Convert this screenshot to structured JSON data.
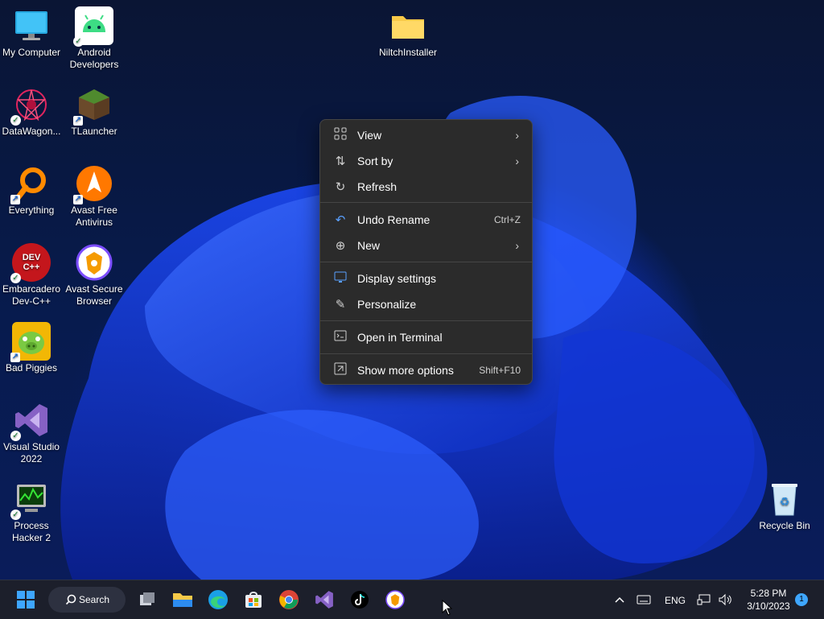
{
  "desktop": {
    "icons": [
      {
        "label": "My Computer",
        "icon": "monitor-icon"
      },
      {
        "label": "Android Developers",
        "icon": "android-icon"
      },
      {
        "label": "NiltchInstaller",
        "icon": "folder-icon"
      },
      {
        "label": "DataWagon...",
        "icon": "datawagon-icon"
      },
      {
        "label": "TLauncher",
        "icon": "tlauncher-icon"
      },
      {
        "label": "Everything",
        "icon": "everything-search-icon"
      },
      {
        "label": "Avast Free Antivirus",
        "icon": "avast-icon"
      },
      {
        "label": "Embarcadero Dev-C++",
        "icon": "devcpp-icon",
        "text": "DEV C++"
      },
      {
        "label": "Avast Secure Browser",
        "icon": "avast-browser-icon"
      },
      {
        "label": "Bad Piggies",
        "icon": "bad-piggies-icon"
      },
      {
        "label": "Visual Studio 2022",
        "icon": "visual-studio-icon"
      },
      {
        "label": "Process Hacker 2",
        "icon": "process-hacker-icon"
      },
      {
        "label": "Recycle Bin",
        "icon": "recycle-bin-icon"
      }
    ]
  },
  "context_menu": {
    "items": [
      {
        "label": "View",
        "icon": "grid-view-icon",
        "submenu": true
      },
      {
        "label": "Sort by",
        "icon": "sort-icon",
        "submenu": true
      },
      {
        "label": "Refresh",
        "icon": "refresh-icon"
      },
      {
        "label": "Undo Rename",
        "icon": "undo-icon",
        "shortcut": "Ctrl+Z"
      },
      {
        "label": "New",
        "icon": "new-plus-icon",
        "submenu": true
      },
      {
        "label": "Display settings",
        "icon": "display-settings-icon"
      },
      {
        "label": "Personalize",
        "icon": "pen-icon"
      },
      {
        "label": "Open in Terminal",
        "icon": "terminal-icon"
      },
      {
        "label": "Show more options",
        "icon": "more-options-icon",
        "shortcut": "Shift+F10"
      }
    ]
  },
  "taskbar": {
    "search_label": "Search",
    "apps": [
      "task-view-icon",
      "file-explorer-icon",
      "edge-icon",
      "store-icon",
      "chrome-icon",
      "visual-studio-icon",
      "tiktok-icon",
      "avast-browser-icon"
    ],
    "tray": {
      "language": "ENG",
      "time": "5:28 PM",
      "date": "3/10/2023",
      "notification_count": "1"
    }
  },
  "colors": {
    "menu_bg": "#2b2b2b",
    "taskbar_bg": "#1c1f2b",
    "accent_blue": "#1f4cff"
  }
}
